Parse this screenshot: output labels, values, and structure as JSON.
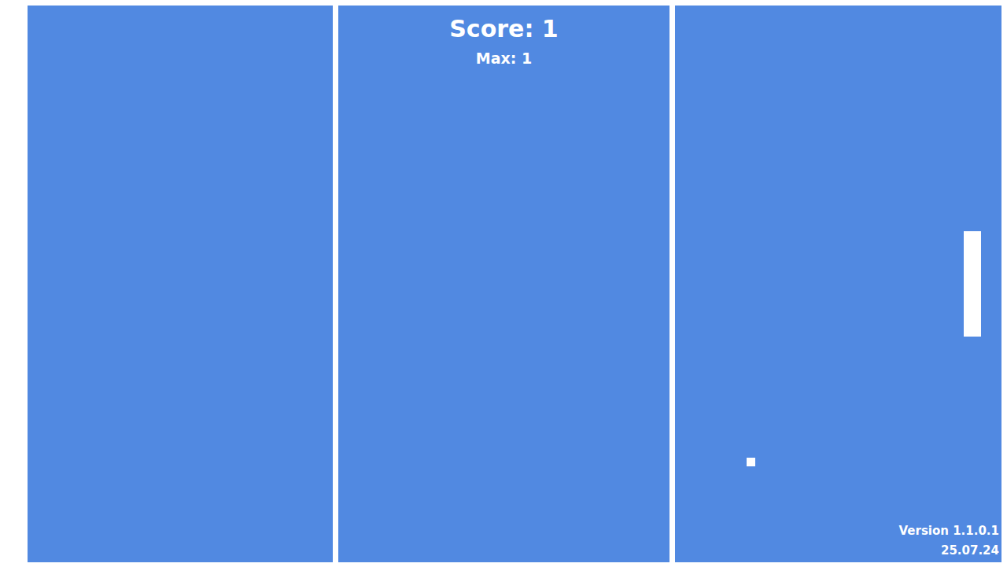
{
  "hud": {
    "score": "Score: 1",
    "max": "Max: 1"
  },
  "footer": {
    "version": "Version 1.1.0.1",
    "date": "25.07.24"
  }
}
